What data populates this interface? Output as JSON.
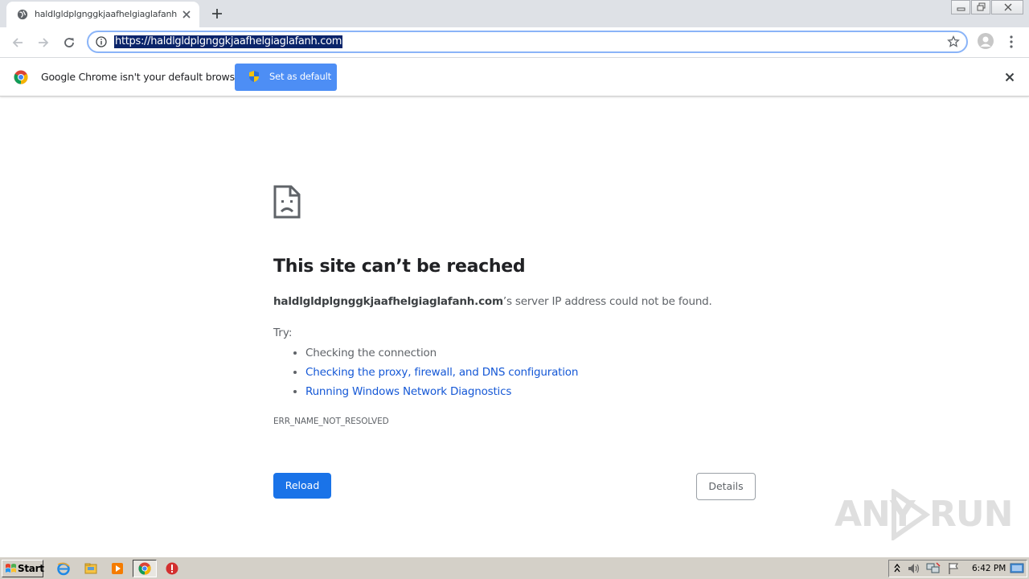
{
  "browser": {
    "tab_title": "haldlgldplgnggkjaafhelgiaglafanh.com",
    "url": "https://haldlgldplgnggkjaafhelgiaglafanh.com",
    "colors": {
      "tabstrip": "#dee1e6",
      "omnibox_border": "#8ab4f8",
      "url_selection": "#0a246a"
    }
  },
  "infobar": {
    "message": "Google Chrome isn't your default browser",
    "button_label": "Set as default",
    "button_color": "#4d8ef5"
  },
  "error_page": {
    "title": "This site can’t be reached",
    "host": "haldlgldplgnggkjaafhelgiaglafanh.com",
    "message_suffix": "’s server IP address could not be found.",
    "try_label": "Try:",
    "suggestions": [
      "Checking the connection",
      "Checking the proxy, firewall, and DNS configuration",
      "Running Windows Network Diagnostics"
    ],
    "error_code": "ERR_NAME_NOT_RESOLVED",
    "reload_label": "Reload",
    "details_label": "Details",
    "colors": {
      "primary_button": "#1a73e8",
      "link": "#1558d6"
    }
  },
  "watermark": {
    "left": "ANY",
    "right": "RUN"
  },
  "taskbar": {
    "start_label": "Start",
    "clock": "6:42 PM"
  }
}
